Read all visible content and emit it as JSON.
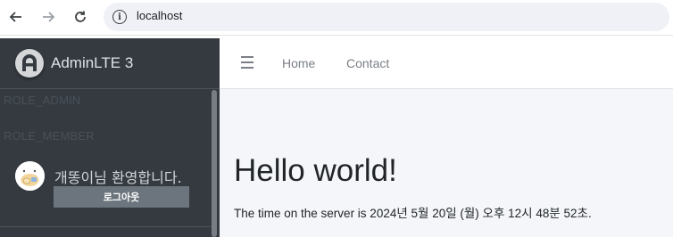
{
  "browser": {
    "url": "localhost"
  },
  "sidebar": {
    "brand": "AdminLTE 3",
    "roles": [
      "ROLE_ADMIN",
      "ROLE_MEMBER"
    ],
    "user": {
      "greeting": "개똥이님 환영합니다.",
      "logout_label": "로그아웃"
    }
  },
  "navbar": {
    "links": [
      "Home",
      "Contact"
    ]
  },
  "main": {
    "heading": "Hello world!",
    "server_time": "The time on the server is 2024년 5월 20일 (월) 오후 12시 48분 52초."
  }
}
